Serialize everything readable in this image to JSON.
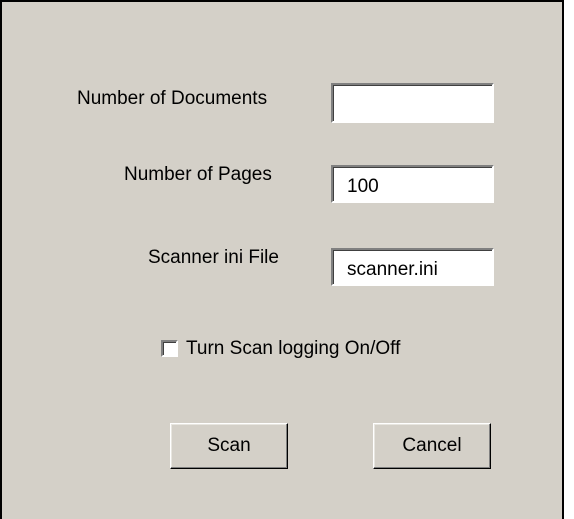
{
  "form": {
    "documents": {
      "label": "Number of Documents",
      "value": ""
    },
    "pages": {
      "label": "Number of Pages",
      "value": "100"
    },
    "ini_file": {
      "label": "Scanner ini File",
      "value": "scanner.ini"
    },
    "logging": {
      "label": "Turn Scan logging On/Off",
      "checked": false
    }
  },
  "buttons": {
    "scan": "Scan",
    "cancel": "Cancel"
  }
}
